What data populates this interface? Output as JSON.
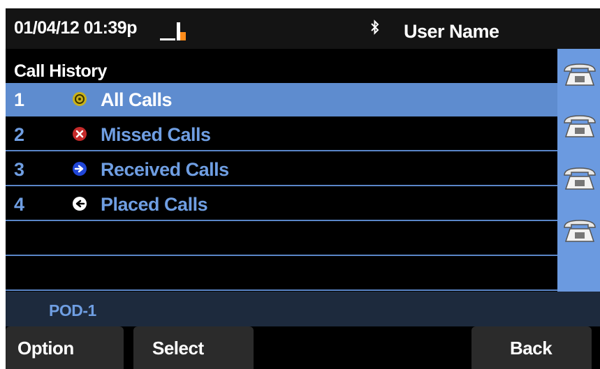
{
  "status_bar": {
    "datetime": "01/04/12 01:39p",
    "user_name": "User Name",
    "icons": [
      "signal-bars-icon",
      "bluetooth-icon"
    ],
    "signal_color": "#ff8c1a"
  },
  "list": {
    "title": "Call History",
    "items": [
      {
        "number": "1",
        "label": "All Calls",
        "icon": "all-calls-icon",
        "icon_color": "#c9b21a",
        "selected": true
      },
      {
        "number": "2",
        "label": "Missed Calls",
        "icon": "missed-calls-icon",
        "icon_color": "#c42a2a",
        "selected": false
      },
      {
        "number": "3",
        "label": "Received Calls",
        "icon": "received-calls-icon",
        "icon_color": "#2046d8",
        "selected": false
      },
      {
        "number": "4",
        "label": "Placed Calls",
        "icon": "placed-calls-icon",
        "icon_color": "#ffffff",
        "selected": false
      }
    ]
  },
  "line_keys": [
    {
      "icon": "phone-icon"
    },
    {
      "icon": "phone-icon"
    },
    {
      "icon": "phone-icon"
    },
    {
      "icon": "phone-icon"
    }
  ],
  "footer": {
    "pod_label": "POD-1"
  },
  "softkeys": {
    "option": "Option",
    "select": "Select",
    "back": "Back"
  },
  "colors": {
    "selected_row": "#5e8ccf",
    "row_text": "#6f9ee2",
    "line_column": "#6b9ae0",
    "footer_bg": "#1d2a3d"
  }
}
